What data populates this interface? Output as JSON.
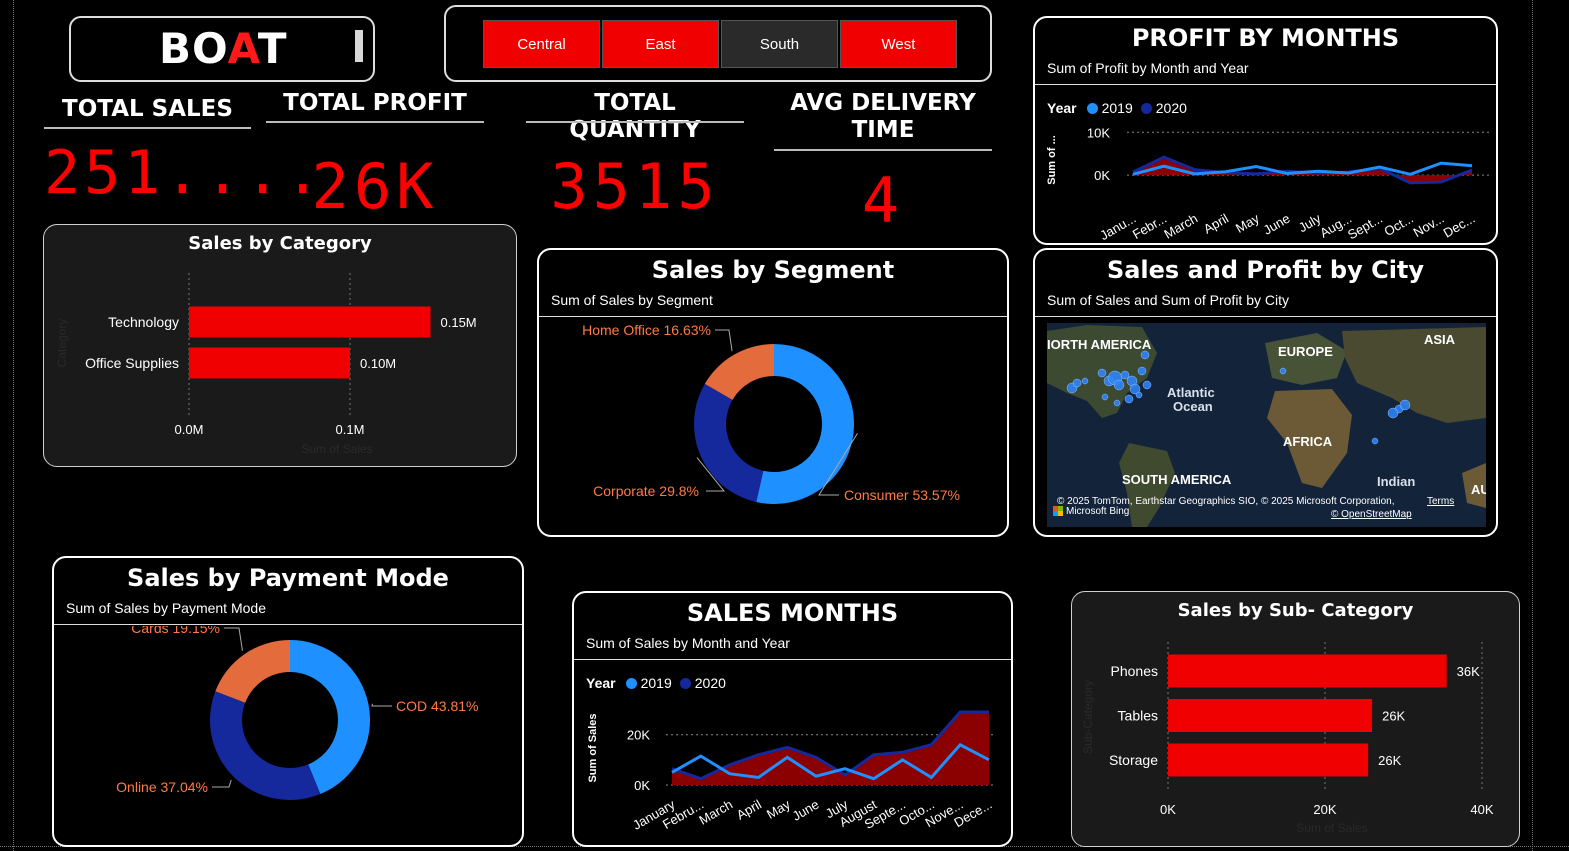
{
  "brand": {
    "part1": "BO",
    "part2": "A",
    "part3": "T"
  },
  "region_slicer": [
    {
      "label": "Central",
      "selected": true
    },
    {
      "label": "East",
      "selected": true
    },
    {
      "label": "South",
      "selected": false
    },
    {
      "label": "West",
      "selected": true
    }
  ],
  "kpis": {
    "total_sales": {
      "label": "TOTAL SALES",
      "value": "251...."
    },
    "total_profit": {
      "label": "TOTAL PROFIT",
      "value": "26K"
    },
    "total_quantity": {
      "label": "TOTAL QUANTITY",
      "value": "3515"
    },
    "avg_delivery": {
      "label_line1": "AVG DELIVERY",
      "label_line2": "TIME",
      "value": "4"
    }
  },
  "colors": {
    "accent": "#ff0000",
    "series_2019": "#1e90ff",
    "series_2020": "#15289c",
    "home_office": "#e46c3c"
  },
  "profit_by_months": {
    "title": "PROFIT BY MONTHS",
    "subtitle": "Sum of Profit by Month and Year",
    "legend_title": "Year",
    "ylabel": "Sum of ...",
    "chart_data": {
      "type": "line",
      "categories": [
        "Janu...",
        "Febr...",
        "March",
        "April",
        "May",
        "June",
        "July",
        "Aug...",
        "Sept...",
        "Oct...",
        "Nov...",
        "Dec..."
      ],
      "yticks": [
        "10K",
        "0K"
      ],
      "ylim": [
        -3000,
        11000
      ],
      "series": [
        {
          "name": "2019",
          "values": [
            200,
            2100,
            300,
            800,
            2000,
            400,
            900,
            500,
            1900,
            200,
            2800,
            2200
          ]
        },
        {
          "name": "2020",
          "values": [
            700,
            4200,
            1300,
            600,
            300,
            900,
            500,
            700,
            1600,
            -1800,
            -1600,
            1200
          ]
        }
      ]
    }
  },
  "sales_by_category": {
    "title": "Sales by Category",
    "ylabel": "Category",
    "xlabel": "Sum of Sales",
    "chart_data": {
      "type": "bar",
      "categories": [
        "Technology",
        "Office Supplies"
      ],
      "values": [
        0.15,
        0.1
      ],
      "value_labels": [
        "0.15M",
        "0.10M"
      ],
      "xticks": [
        "0.0M",
        "0.1M"
      ],
      "xlim": [
        0,
        0.18
      ]
    }
  },
  "sales_by_segment": {
    "title": "Sales by Segment",
    "subtitle": "Sum of Sales by Segment",
    "chart_data": {
      "type": "pie",
      "labels": [
        "Consumer 53.57%",
        "Corporate 29.8%",
        "Home Office 16.63%"
      ],
      "values": [
        53.57,
        29.8,
        16.63
      ]
    }
  },
  "city_map": {
    "title": "Sales and Profit by City",
    "subtitle": "Sum of Sales and Sum of Profit by City",
    "labels": {
      "na": "IORTH AMERICA",
      "europe": "EUROPE",
      "asia": "ASIA",
      "atl1": "Atlantic",
      "atl2": "Ocean",
      "africa": "AFRICA",
      "sa": "SOUTH AMERICA",
      "indian": "Indian",
      "au": "AU"
    },
    "attribution": "© 2025 TomTom, Earthstar Geographics SIO, © 2025 Microsoft Corporation,",
    "terms": "Terms",
    "osm": "© OpenStreetMap",
    "bing": "Microsoft Bing"
  },
  "sales_by_payment": {
    "title": "Sales by Payment Mode",
    "subtitle": "Sum of Sales by Payment Mode",
    "chart_data": {
      "type": "pie",
      "labels": [
        "COD 43.81%",
        "Online 37.04%",
        "Cards 19.15%"
      ],
      "values": [
        43.81,
        37.04,
        19.15
      ]
    }
  },
  "sales_months": {
    "title": "SALES MONTHS",
    "subtitle": "Sum of Sales by Month and Year",
    "legend_title": "Year",
    "ylabel": "Sum of Sales",
    "chart_data": {
      "type": "area",
      "categories": [
        "January",
        "Febru...",
        "March",
        "April",
        "May",
        "June",
        "July",
        "August",
        "Septe...",
        "Octo...",
        "Nove...",
        "Dece..."
      ],
      "yticks": [
        "20K",
        "0K"
      ],
      "ylim": [
        0,
        33000
      ],
      "series": [
        {
          "name": "2019",
          "values": [
            5000,
            11500,
            4500,
            3000,
            11000,
            3500,
            6500,
            2500,
            10000,
            3000,
            16000,
            10000
          ]
        },
        {
          "name": "2020",
          "values": [
            6500,
            2500,
            8000,
            12000,
            15000,
            11000,
            4000,
            12000,
            13000,
            16000,
            29000,
            29000
          ]
        }
      ]
    }
  },
  "sales_by_subcategory": {
    "title": "Sales by Sub- Category",
    "ylabel": "Sub-Category",
    "xlabel": "Sum of Sales",
    "chart_data": {
      "type": "bar",
      "categories": [
        "Phones",
        "Tables",
        "Storage"
      ],
      "values": [
        35500,
        26000,
        25500
      ],
      "value_labels": [
        "36K",
        "26K",
        "26K"
      ],
      "xticks": [
        "0K",
        "20K",
        "40K"
      ],
      "xlim": [
        0,
        40000
      ]
    }
  }
}
